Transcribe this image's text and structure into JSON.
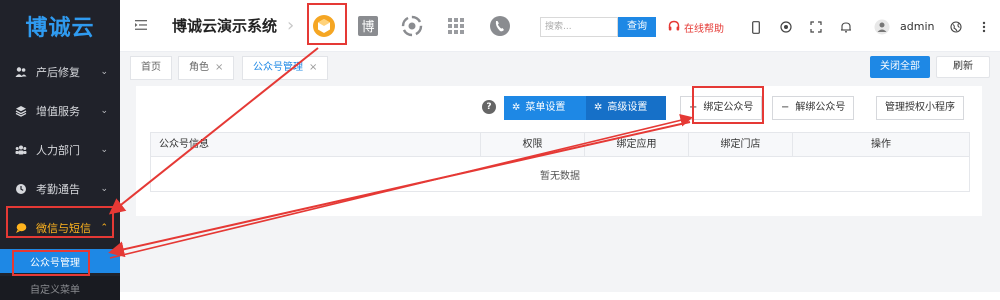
{
  "sidebar": {
    "logo": "博诚云",
    "items": [
      {
        "label": "产后修复",
        "icon": "people-icon"
      },
      {
        "label": "增值服务",
        "icon": "layers-icon"
      },
      {
        "label": "人力部门",
        "icon": "team-icon"
      },
      {
        "label": "考勤通告",
        "icon": "clock-icon"
      },
      {
        "label": "微信与短信",
        "icon": "chat-bubble-icon"
      }
    ],
    "subitems": [
      {
        "label": "公众号管理"
      },
      {
        "label": "自定义菜单"
      }
    ]
  },
  "topbar": {
    "title": "博诚云演示系统",
    "search_placeholder": "搜索...",
    "search_button": "查询",
    "help": "在线帮助",
    "user": "admin"
  },
  "tabs": {
    "items": [
      {
        "label": "首页"
      },
      {
        "label": "角色"
      },
      {
        "label": "公众号管理"
      }
    ],
    "close_all": "关闭全部",
    "refresh": "刷新"
  },
  "toolbar": {
    "help": "?",
    "menu_settings": "菜单设置",
    "advanced_settings": "高级设置",
    "bind_account": "绑定公众号",
    "unbind_account": "解绑公众号",
    "manage_miniprogram": "管理授权小程序"
  },
  "table": {
    "columns": [
      "公众号信息",
      "权限",
      "绑定应用",
      "绑定门店",
      "操作"
    ],
    "empty": "暂无数据"
  },
  "colors": {
    "accent": "#1e88e5",
    "sidebar_bg": "#20222a",
    "highlight_red": "#e53935"
  }
}
